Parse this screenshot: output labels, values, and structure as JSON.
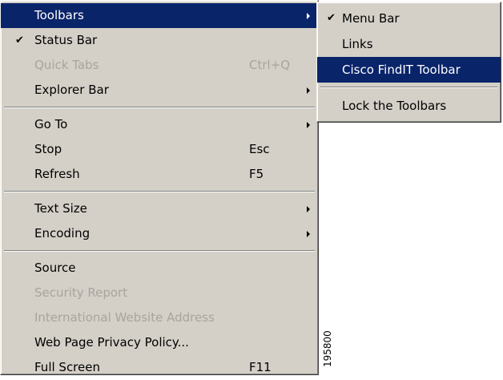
{
  "main_menu": {
    "items": [
      {
        "label": "Toolbars"
      },
      {
        "label": "Status Bar",
        "check": "✔"
      },
      {
        "label": "Quick Tabs",
        "shortcut": "Ctrl+Q"
      },
      {
        "label": "Explorer Bar"
      },
      {
        "label": "Go To"
      },
      {
        "label": "Stop",
        "shortcut": "Esc"
      },
      {
        "label": "Refresh",
        "shortcut": "F5"
      },
      {
        "label": "Text Size"
      },
      {
        "label": "Encoding"
      },
      {
        "label": "Source"
      },
      {
        "label": "Security Report"
      },
      {
        "label": "International Website Address"
      },
      {
        "label": "Web Page Privacy Policy..."
      },
      {
        "label": "Full Screen",
        "shortcut": "F11"
      }
    ]
  },
  "sub_menu": {
    "items": [
      {
        "label": "Menu Bar",
        "check": "✔"
      },
      {
        "label": "Links"
      },
      {
        "label": "Cisco FindIT Toolbar"
      },
      {
        "label": "Lock the Toolbars"
      }
    ]
  },
  "figure_number": "195800",
  "colors": {
    "highlight": "#0a246a",
    "menu_bg": "#d4d0c8",
    "disabled_text": "#a7a49e"
  }
}
